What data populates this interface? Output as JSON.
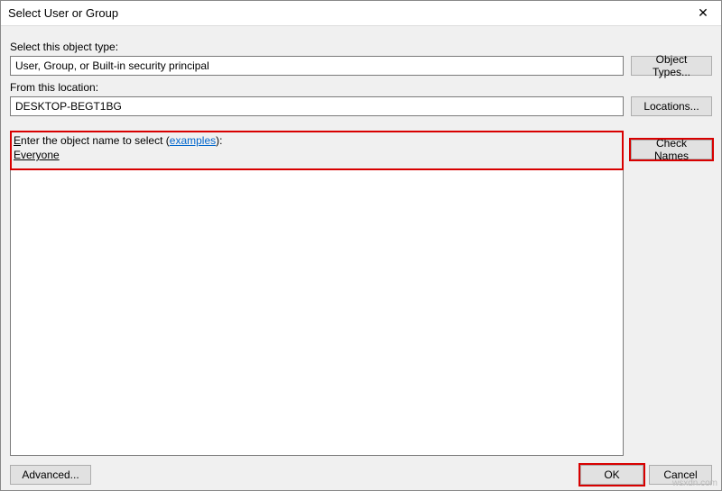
{
  "window": {
    "title": "Select User or Group",
    "close_glyph": "✕"
  },
  "object_type": {
    "label": "Select this object type:",
    "value": "User, Group, or Built-in security principal",
    "button": "Object Types..."
  },
  "location": {
    "label": "From this location:",
    "value": "DESKTOP-BEGT1BG",
    "button": "Locations..."
  },
  "object_name": {
    "label_prefix_underlined": "E",
    "label_rest": "nter the object name to select (",
    "examples_link": "examples",
    "label_suffix": "):",
    "value": "Everyone",
    "button": "Check Names"
  },
  "footer": {
    "advanced": "Advanced...",
    "ok": "OK",
    "cancel": "Cancel"
  },
  "watermark": "wsxdn.com"
}
